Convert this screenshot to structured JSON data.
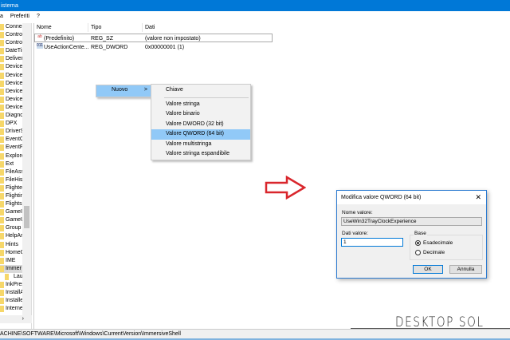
{
  "window": {
    "title": "istema"
  },
  "menubar": [
    "a",
    "Preferiti",
    "?"
  ],
  "tree": {
    "items": [
      "Connec",
      "Contro",
      "Contro",
      "DateTir",
      "Delivery",
      "Device",
      "Device",
      "Device",
      "DeviceF",
      "DeviceS",
      "Devices",
      "Diagno",
      "DPX",
      "DriverS",
      "EventC",
      "EventF",
      "Explore",
      "Ext",
      "FileAss",
      "FileHist",
      "Flighte",
      "Flightin",
      "FlightsI",
      "GameIn",
      "GameU",
      "Group I",
      "HelpAr",
      "Hints",
      "HomeG",
      "IME",
      "Immer",
      "Lau",
      "InkPres",
      "InstallA",
      "Installe",
      "Interne"
    ],
    "selected": "Immer",
    "child": "Lau"
  },
  "list": {
    "headers": [
      "Nome",
      "Tipo",
      "Dati"
    ],
    "rows": [
      {
        "icon": "ab",
        "name": "(Predefinito)",
        "type": "REG_SZ",
        "data": "(valore non impostato)"
      },
      {
        "icon": "011",
        "name": "UseActionCente...",
        "type": "REG_DWORD",
        "data": "0x00000001 (1)"
      }
    ]
  },
  "context_menu": {
    "item": "Nuovo",
    "arrow": ">",
    "submenu": [
      "Chiave",
      "Valore stringa",
      "Valore binario",
      "Valore DWORD (32 bit)",
      "Valore QWORD (64 bit)",
      "Valore multistringa",
      "Valore stringa espandibile"
    ],
    "highlighted": "Valore QWORD (64 bit)"
  },
  "dialog": {
    "title": "Modifica valore QWORD (64 bit)",
    "close": "✕",
    "name_label": "Nome valore:",
    "name_value": "UseWin32TrayClockExperience",
    "data_label": "Dati valore:",
    "data_value": "1",
    "base_label": "Base",
    "radio_hex": "Esadecimale",
    "radio_dec": "Decimale",
    "selected_base": "Esadecimale",
    "ok": "OK",
    "cancel": "Annulla"
  },
  "status": {
    "path": "ACHINE\\SOFTWARE\\Microsoft\\Windows\\CurrentVersion\\ImmersiveShell"
  },
  "watermark": "DESKTOP SOL",
  "colors": {
    "titlebar": "#0078d7",
    "highlight": "#91c9f7",
    "arrow": "#d9262c"
  }
}
